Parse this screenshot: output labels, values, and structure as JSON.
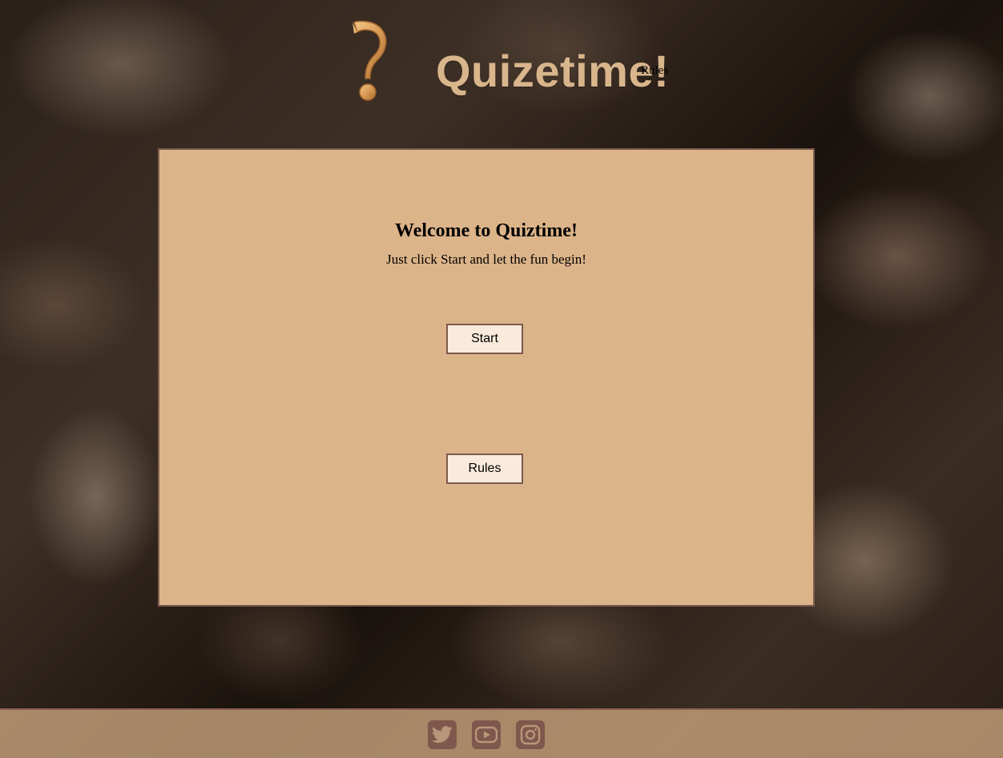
{
  "header": {
    "logo_icon": "question-mark-icon",
    "title": "Quizetime!",
    "nav_rules_label": "Rules"
  },
  "card": {
    "title": "Welcome to Quiztime!",
    "subtitle": "Just click Start and let the fun begin!",
    "start_label": "Start",
    "rules_label": "Rules"
  },
  "footer": {
    "icons": [
      "twitter-icon",
      "youtube-icon",
      "instagram-icon"
    ]
  },
  "colors": {
    "brand": "#d9b58c",
    "card_bg": "#dcb489",
    "button_bg": "#faeadb",
    "border": "#7b5a4d",
    "footer_icon": "#7e584c"
  }
}
